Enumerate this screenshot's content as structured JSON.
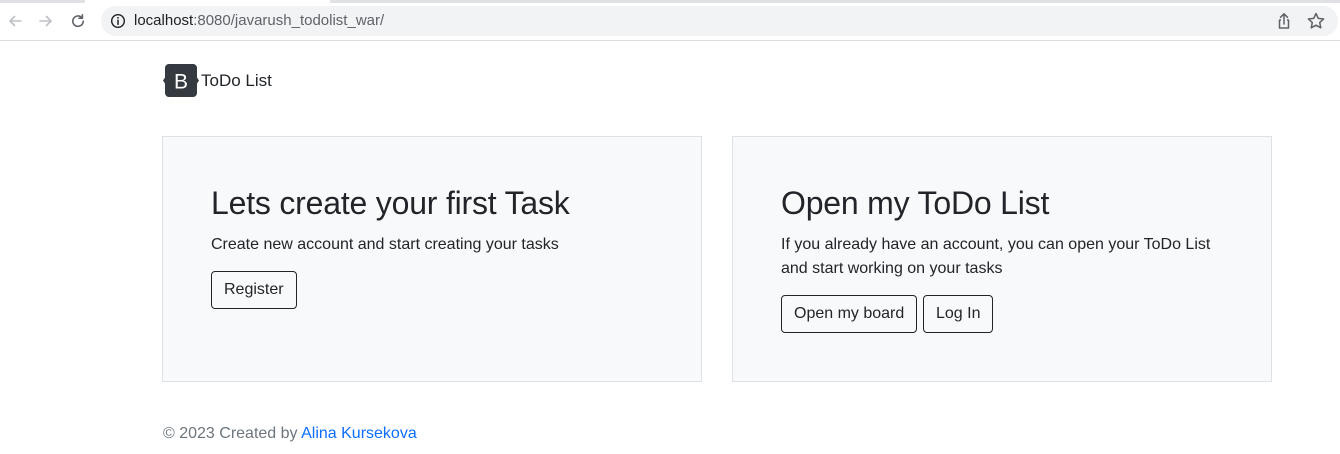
{
  "browser": {
    "url_host": "localhost",
    "url_rest": ":8080/javarush_todolist_war/",
    "back_icon": "arrow-left-icon",
    "forward_icon": "arrow-right-icon",
    "reload_icon": "reload-icon",
    "info_icon": "info-icon",
    "share_icon": "share-icon",
    "star_icon": "star-icon"
  },
  "navbar": {
    "logo_letter": "B",
    "brand_text": "ToDo List"
  },
  "cards": {
    "left": {
      "title": "Lets create your first Task",
      "text": "Create new account and start creating your tasks",
      "button": "Register"
    },
    "right": {
      "title": "Open my ToDo List",
      "text": "If you already have an account, you can open your ToDo List and start working on your tasks",
      "button_open": "Open my board",
      "button_login": "Log In"
    }
  },
  "footer": {
    "prefix": "© 2023 Created by ",
    "author": "Alina Kursekova"
  },
  "colors": {
    "card_bg": "#f8f9fa",
    "card_border": "#dee2e6",
    "link": "#0d6efd",
    "muted": "#6c757d",
    "logo_bg": "#343a40"
  }
}
